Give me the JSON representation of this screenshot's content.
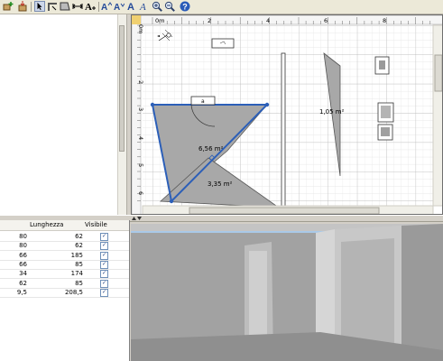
{
  "toolbar": {
    "buttons": [
      {
        "name": "add-furniture-icon"
      },
      {
        "name": "import-furniture-icon"
      },
      {
        "name": "select-mode-icon"
      },
      {
        "name": "create-walls-icon"
      },
      {
        "name": "create-rooms-icon"
      },
      {
        "name": "create-dimensions-icon"
      },
      {
        "name": "add-text-icon"
      },
      {
        "name": "zoom-in-icon"
      },
      {
        "name": "zoom-out-icon"
      },
      {
        "name": "help-icon"
      }
    ]
  },
  "plan": {
    "ruler_origin": "0m",
    "ruler_x": [
      "0m",
      "2",
      "4",
      "6",
      "8"
    ],
    "ruler_y": [
      "0m",
      "2",
      "3",
      "4",
      "5",
      "6"
    ],
    "room_areas": [
      "6,56 m²",
      "3,35 m²",
      "1,05 m²"
    ],
    "door_label": "a"
  },
  "furniture_table": {
    "columns": [
      "",
      "Lunghezza",
      "Visibile"
    ],
    "rows": [
      {
        "width": "80",
        "length": "62",
        "visible": "✓"
      },
      {
        "width": "80",
        "length": "62",
        "visible": "✓"
      },
      {
        "width": "66",
        "length": "185",
        "visible": "✓"
      },
      {
        "width": "66",
        "length": "85",
        "visible": "✓"
      },
      {
        "width": "34",
        "length": "174",
        "visible": "✓"
      },
      {
        "width": "62",
        "length": "85",
        "visible": "✓"
      },
      {
        "width": "9,5",
        "length": "208,5",
        "visible": "✓"
      }
    ]
  },
  "colors": {
    "room_fill": "#a8a8a8",
    "wall_selected": "#2c5fb8",
    "grid": "#d9d9d9",
    "sky": "#a9c9e8"
  }
}
